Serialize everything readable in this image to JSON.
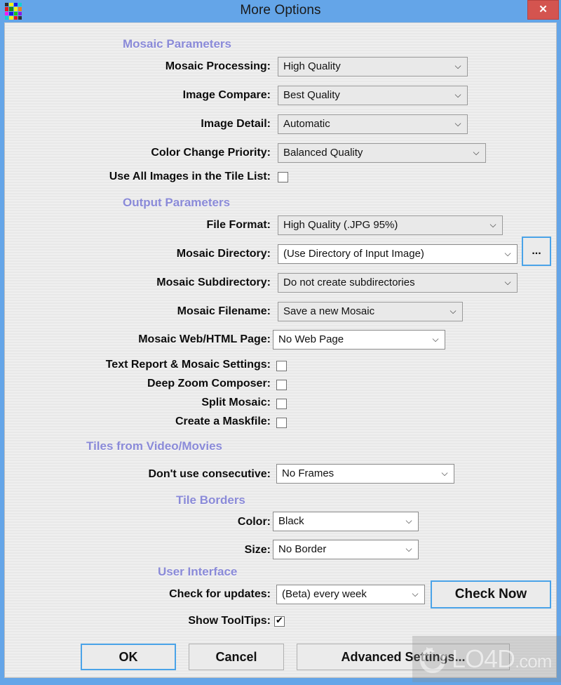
{
  "window": {
    "title": "More Options",
    "app_icon": "mosaic-grid-icon",
    "close_label": "✕",
    "accent_blue": "#64a5e8",
    "close_red": "#d4544f",
    "section_purple": "#8a8ad8"
  },
  "sections": {
    "mosaic_parameters": "Mosaic Parameters",
    "output_parameters": "Output Parameters",
    "tiles_from_video": "Tiles from Video/Movies",
    "tile_borders": "Tile Borders",
    "user_interface": "User Interface"
  },
  "fields": {
    "mosaic_processing": {
      "label": "Mosaic Processing:",
      "value": "High Quality"
    },
    "image_compare": {
      "label": "Image Compare:",
      "value": "Best Quality"
    },
    "image_detail": {
      "label": "Image Detail:",
      "value": "Automatic"
    },
    "color_change_priority": {
      "label": "Color Change Priority:",
      "value": "Balanced Quality"
    },
    "use_all_images": {
      "label": "Use All Images in the Tile List:",
      "checked": false
    },
    "file_format": {
      "label": "File Format:",
      "value": "High Quality (.JPG 95%)"
    },
    "mosaic_directory": {
      "label": "Mosaic Directory:",
      "value": "(Use Directory of Input Image)",
      "browse_label": "..."
    },
    "mosaic_subdirectory": {
      "label": "Mosaic Subdirectory:",
      "value": "Do not create subdirectories"
    },
    "mosaic_filename": {
      "label": "Mosaic Filename:",
      "value": "Save a new Mosaic"
    },
    "mosaic_web_page": {
      "label": "Mosaic Web/HTML Page:",
      "value": "No Web Page"
    },
    "text_report": {
      "label": "Text Report & Mosaic Settings:",
      "checked": false
    },
    "deep_zoom": {
      "label": "Deep Zoom Composer:",
      "checked": false
    },
    "split_mosaic": {
      "label": "Split Mosaic:",
      "checked": false
    },
    "create_maskfile": {
      "label": "Create a Maskfile:",
      "checked": false
    },
    "dont_use_consecutive": {
      "label": "Don't use consecutive:",
      "value": "No Frames"
    },
    "border_color": {
      "label": "Color:",
      "value": "Black"
    },
    "border_size": {
      "label": "Size:",
      "value": "No Border"
    },
    "check_for_updates": {
      "label": "Check for updates:",
      "value": "(Beta) every week",
      "button_label": "Check Now"
    },
    "show_tooltips": {
      "label": "Show ToolTips:",
      "checked": true
    }
  },
  "footer": {
    "ok": "OK",
    "cancel": "Cancel",
    "advanced": "Advanced Settings..."
  },
  "watermark": {
    "text": "LO4D",
    "suffix": ".com"
  },
  "icons": {
    "chevron_down": "⌄",
    "checkmark": "✔"
  }
}
